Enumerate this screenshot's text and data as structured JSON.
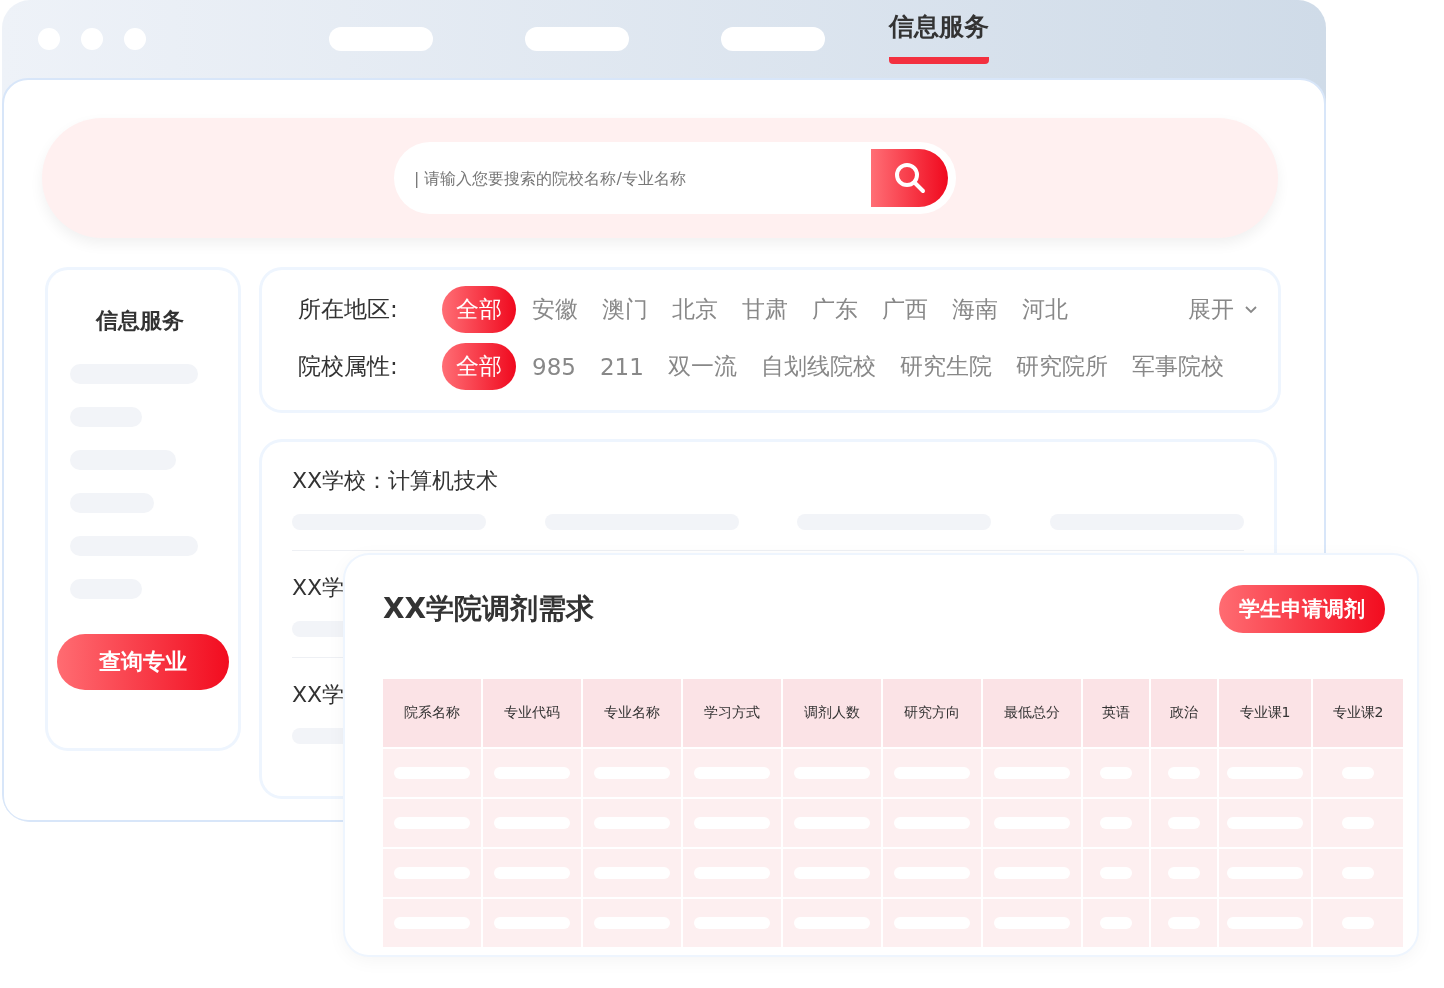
{
  "tabs": [
    {
      "label": "信息服务",
      "selected": true
    }
  ],
  "search": {
    "placeholder": "| 请输入您要搜索的院校名称/专业名称"
  },
  "sidebar": {
    "title": "信息服务",
    "button": "查询专业"
  },
  "filters": [
    {
      "label": "所在地区:",
      "options": [
        {
          "label": "全部",
          "selected": true
        },
        {
          "label": "安徽",
          "selected": false
        },
        {
          "label": "澳门",
          "selected": false
        },
        {
          "label": "北京",
          "selected": false
        },
        {
          "label": "甘肃",
          "selected": false
        },
        {
          "label": "广东",
          "selected": false
        },
        {
          "label": "广西",
          "selected": false
        },
        {
          "label": "海南",
          "selected": false
        },
        {
          "label": "河北",
          "selected": false
        }
      ],
      "expand": "展开"
    },
    {
      "label": "院校属性:",
      "options": [
        {
          "label": "全部",
          "selected": true
        },
        {
          "label": "985",
          "selected": false
        },
        {
          "label": "211",
          "selected": false
        },
        {
          "label": "双一流",
          "selected": false
        },
        {
          "label": "自划线院校",
          "selected": false
        },
        {
          "label": "研究生院",
          "selected": false
        },
        {
          "label": "研究院所",
          "selected": false
        },
        {
          "label": "军事院校",
          "selected": false
        }
      ]
    }
  ],
  "results": [
    "XX学校：计算机技术",
    "XX学",
    "XX学"
  ],
  "panel": {
    "title": "XX学院调剂需求",
    "button": "学生申请调剂",
    "columns": [
      "院系名称",
      "专业代码",
      "专业名称",
      "学习方式",
      "调剂人数",
      "研究方向",
      "最低总分",
      "英语",
      "政治",
      "专业课1",
      "专业课2"
    ]
  }
}
